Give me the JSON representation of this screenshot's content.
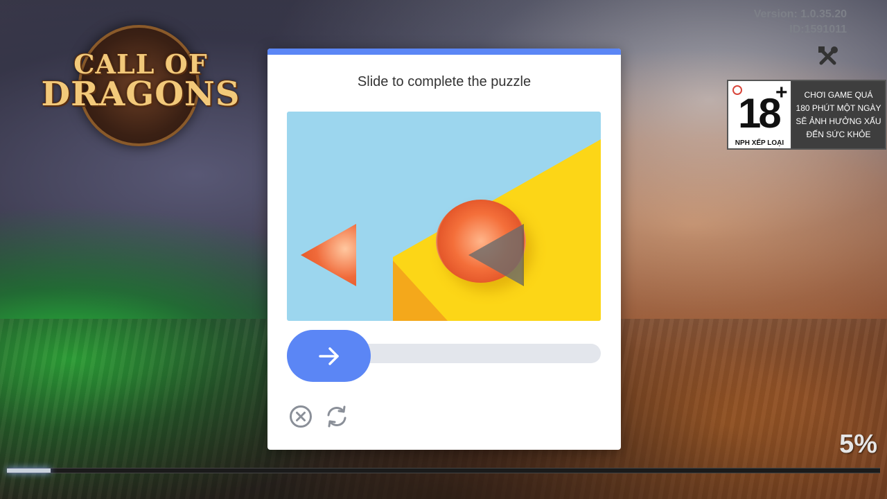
{
  "header": {
    "version": "Version: 1.0.35.20",
    "user_id": "ID:1591011"
  },
  "logo": {
    "line1": "CALL OF",
    "line2": "DRAGONS"
  },
  "rating": {
    "age": "18",
    "plus": "+",
    "rated_by": "NPH XẾP LOẠI",
    "warning_lines": [
      "CHƠI GAME QUÁ",
      "180 PHÚT MỘT NGÀY",
      "SẼ ẢNH HƯỞNG XẤU",
      "ĐẾN SỨC KHỎE"
    ]
  },
  "loading": {
    "percent_label": "5%",
    "progress": 0.05
  },
  "captcha": {
    "title": "Slide to complete the puzzle",
    "accent_color": "#5b86f5",
    "slider_icon": "arrow-right-icon",
    "close_icon": "close-circle-icon",
    "refresh_icon": "refresh-icon"
  }
}
